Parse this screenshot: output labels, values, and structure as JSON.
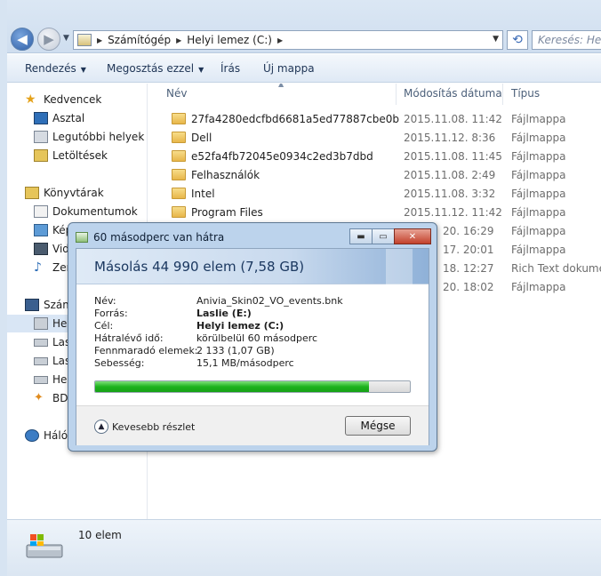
{
  "nav": {
    "back_glyph": "◀",
    "fwd_glyph": "▶"
  },
  "address": {
    "crumbs": [
      "Számítógép",
      "Helyi lemez (C:)"
    ],
    "search_placeholder": "Keresés: Helyi"
  },
  "toolbar": {
    "items": [
      "Rendezés",
      "Megosztás ezzel",
      "Írás",
      "Új mappa"
    ]
  },
  "navpane": {
    "items": [
      {
        "label": "Kedvencek",
        "icon": "star-icon"
      },
      {
        "label": "Asztal",
        "icon": "desktop-icon"
      },
      {
        "label": "Legutóbbi helyek",
        "icon": "recent-places-icon"
      },
      {
        "label": "Letöltések",
        "icon": "downloads-icon"
      },
      {
        "label": "Könyvtárak",
        "icon": "libraries-icon"
      },
      {
        "label": "Dokumentumok",
        "icon": "documents-icon"
      },
      {
        "label": "Képek",
        "icon": "pictures-icon"
      },
      {
        "label": "Videók",
        "icon": "videos-icon"
      },
      {
        "label": "Zene",
        "icon": "music-icon"
      },
      {
        "label": "Számítógép",
        "icon": "computer-icon"
      },
      {
        "label": "Helyi lemez (C:)",
        "icon": "local-disk-icon"
      },
      {
        "label": "Laslie (D:)",
        "icon": "drive-icon"
      },
      {
        "label": "Laslie (E:)",
        "icon": "drive-icon"
      },
      {
        "label": "Helyi lemez",
        "icon": "drive-icon"
      },
      {
        "label": "BD-ROM",
        "icon": "bd-drive-icon"
      },
      {
        "label": "Hálózat",
        "icon": "network-icon"
      }
    ]
  },
  "filelist": {
    "headers": {
      "name": "Név",
      "date": "Módosítás dátuma",
      "type": "Típus"
    },
    "rows": [
      {
        "name": "27fa4280edcfbd6681a5ed77887cbe0b",
        "date": "2015.11.08. 11:42",
        "type": "Fájlmappa"
      },
      {
        "name": "Dell",
        "date": "2015.11.12. 8:36",
        "type": "Fájlmappa"
      },
      {
        "name": "e52fa4fb72045e0934c2ed3b7dbd",
        "date": "2015.11.08. 11:45",
        "type": "Fájlmappa"
      },
      {
        "name": "Felhasználók",
        "date": "2015.11.08. 2:49",
        "type": "Fájlmappa"
      },
      {
        "name": "Intel",
        "date": "2015.11.08. 3:32",
        "type": "Fájlmappa"
      },
      {
        "name": "Program Files",
        "date": "2015.11.12. 11:42",
        "type": "Fájlmappa"
      },
      {
        "name": "",
        "date": "20. 16:29",
        "type": "Fájlmappa"
      },
      {
        "name": "",
        "date": "17. 20:01",
        "type": "Fájlmappa"
      },
      {
        "name": "",
        "date": "18. 12:27",
        "type": "Rich Text dokume..."
      },
      {
        "name": "",
        "date": "20. 18:02",
        "type": "Fájlmappa"
      }
    ]
  },
  "status": {
    "count": "10 elem"
  },
  "dialog": {
    "title": "60 másodperc van hátra",
    "heading": "Másolás 44 990 elem (7,58 GB)",
    "fields": [
      {
        "label": "Név:",
        "value": "Anivia_Skin02_VO_events.bnk",
        "bold": false
      },
      {
        "label": "Forrás:",
        "value": "Laslie (E:)",
        "bold": true
      },
      {
        "label": "Cél:",
        "value": "Helyi lemez (C:)",
        "bold": true
      },
      {
        "label": "Hátralévő idő:",
        "value": "körülbelül 60 másodperc",
        "bold": false
      },
      {
        "label": "Fennmaradó elemek:",
        "value": "2 133 (1,07 GB)",
        "bold": false
      },
      {
        "label": "Sebesség:",
        "value": "15,1 MB/másodperc",
        "bold": false
      }
    ],
    "progress_fraction": 0.87,
    "less_details": "Kevesebb részlet",
    "cancel": "Mégse"
  },
  "colors": {
    "progress": "#1eb31e",
    "close_button": "#c2412b",
    "selected_nav": "#d9e6f5"
  }
}
